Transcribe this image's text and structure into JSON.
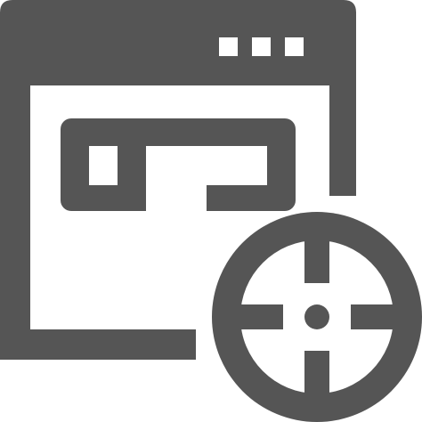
{
  "icon": {
    "name": "browser-window-target-icon",
    "color": "#555555",
    "background": "#ffffff",
    "parts": {
      "window": "browser-window-icon",
      "menu_dots": "ellipsis-icon",
      "content_block": "layout-block-icon",
      "target": "crosshair-target-icon"
    }
  }
}
